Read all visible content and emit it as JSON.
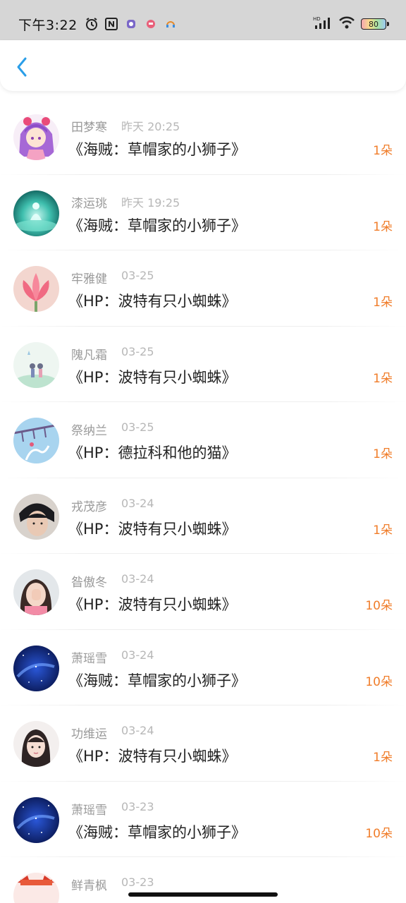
{
  "status_bar": {
    "time": "下午3:22",
    "battery": "80"
  },
  "nav": {
    "back_icon": "chevron-left-icon"
  },
  "colors": {
    "accent": "#2a9ee8",
    "count": "#f07d2a"
  },
  "items": [
    {
      "name": "田梦寒",
      "time": "昨天 20:25",
      "title": "《海贼：草帽家的小狮子》",
      "count": "1朵"
    },
    {
      "name": "漆运珧",
      "time": "昨天 19:25",
      "title": "《海贼：草帽家的小狮子》",
      "count": "1朵"
    },
    {
      "name": "牢雅健",
      "time": "03-25",
      "title": "《HP：波特有只小蜘蛛》",
      "count": "1朵"
    },
    {
      "name": "隗凡霜",
      "time": "03-25",
      "title": "《HP：波特有只小蜘蛛》",
      "count": "1朵"
    },
    {
      "name": "祭纳兰",
      "time": "03-25",
      "title": "《HP：德拉科和他的猫》",
      "count": "1朵"
    },
    {
      "name": "戎茂彦",
      "time": "03-24",
      "title": "《HP：波特有只小蜘蛛》",
      "count": "1朵"
    },
    {
      "name": "昝傲冬",
      "time": "03-24",
      "title": "《HP：波特有只小蜘蛛》",
      "count": "10朵"
    },
    {
      "name": "萧瑶雪",
      "time": "03-24",
      "title": "《海贼：草帽家的小狮子》",
      "count": "10朵"
    },
    {
      "name": "功维运",
      "time": "03-24",
      "title": "《HP：波特有只小蜘蛛》",
      "count": "1朵"
    },
    {
      "name": "萧瑶雪",
      "time": "03-23",
      "title": "《海贼：草帽家的小狮子》",
      "count": "10朵"
    },
    {
      "name": "鲜青枫",
      "time": "03-23",
      "title": "",
      "count": ""
    }
  ]
}
